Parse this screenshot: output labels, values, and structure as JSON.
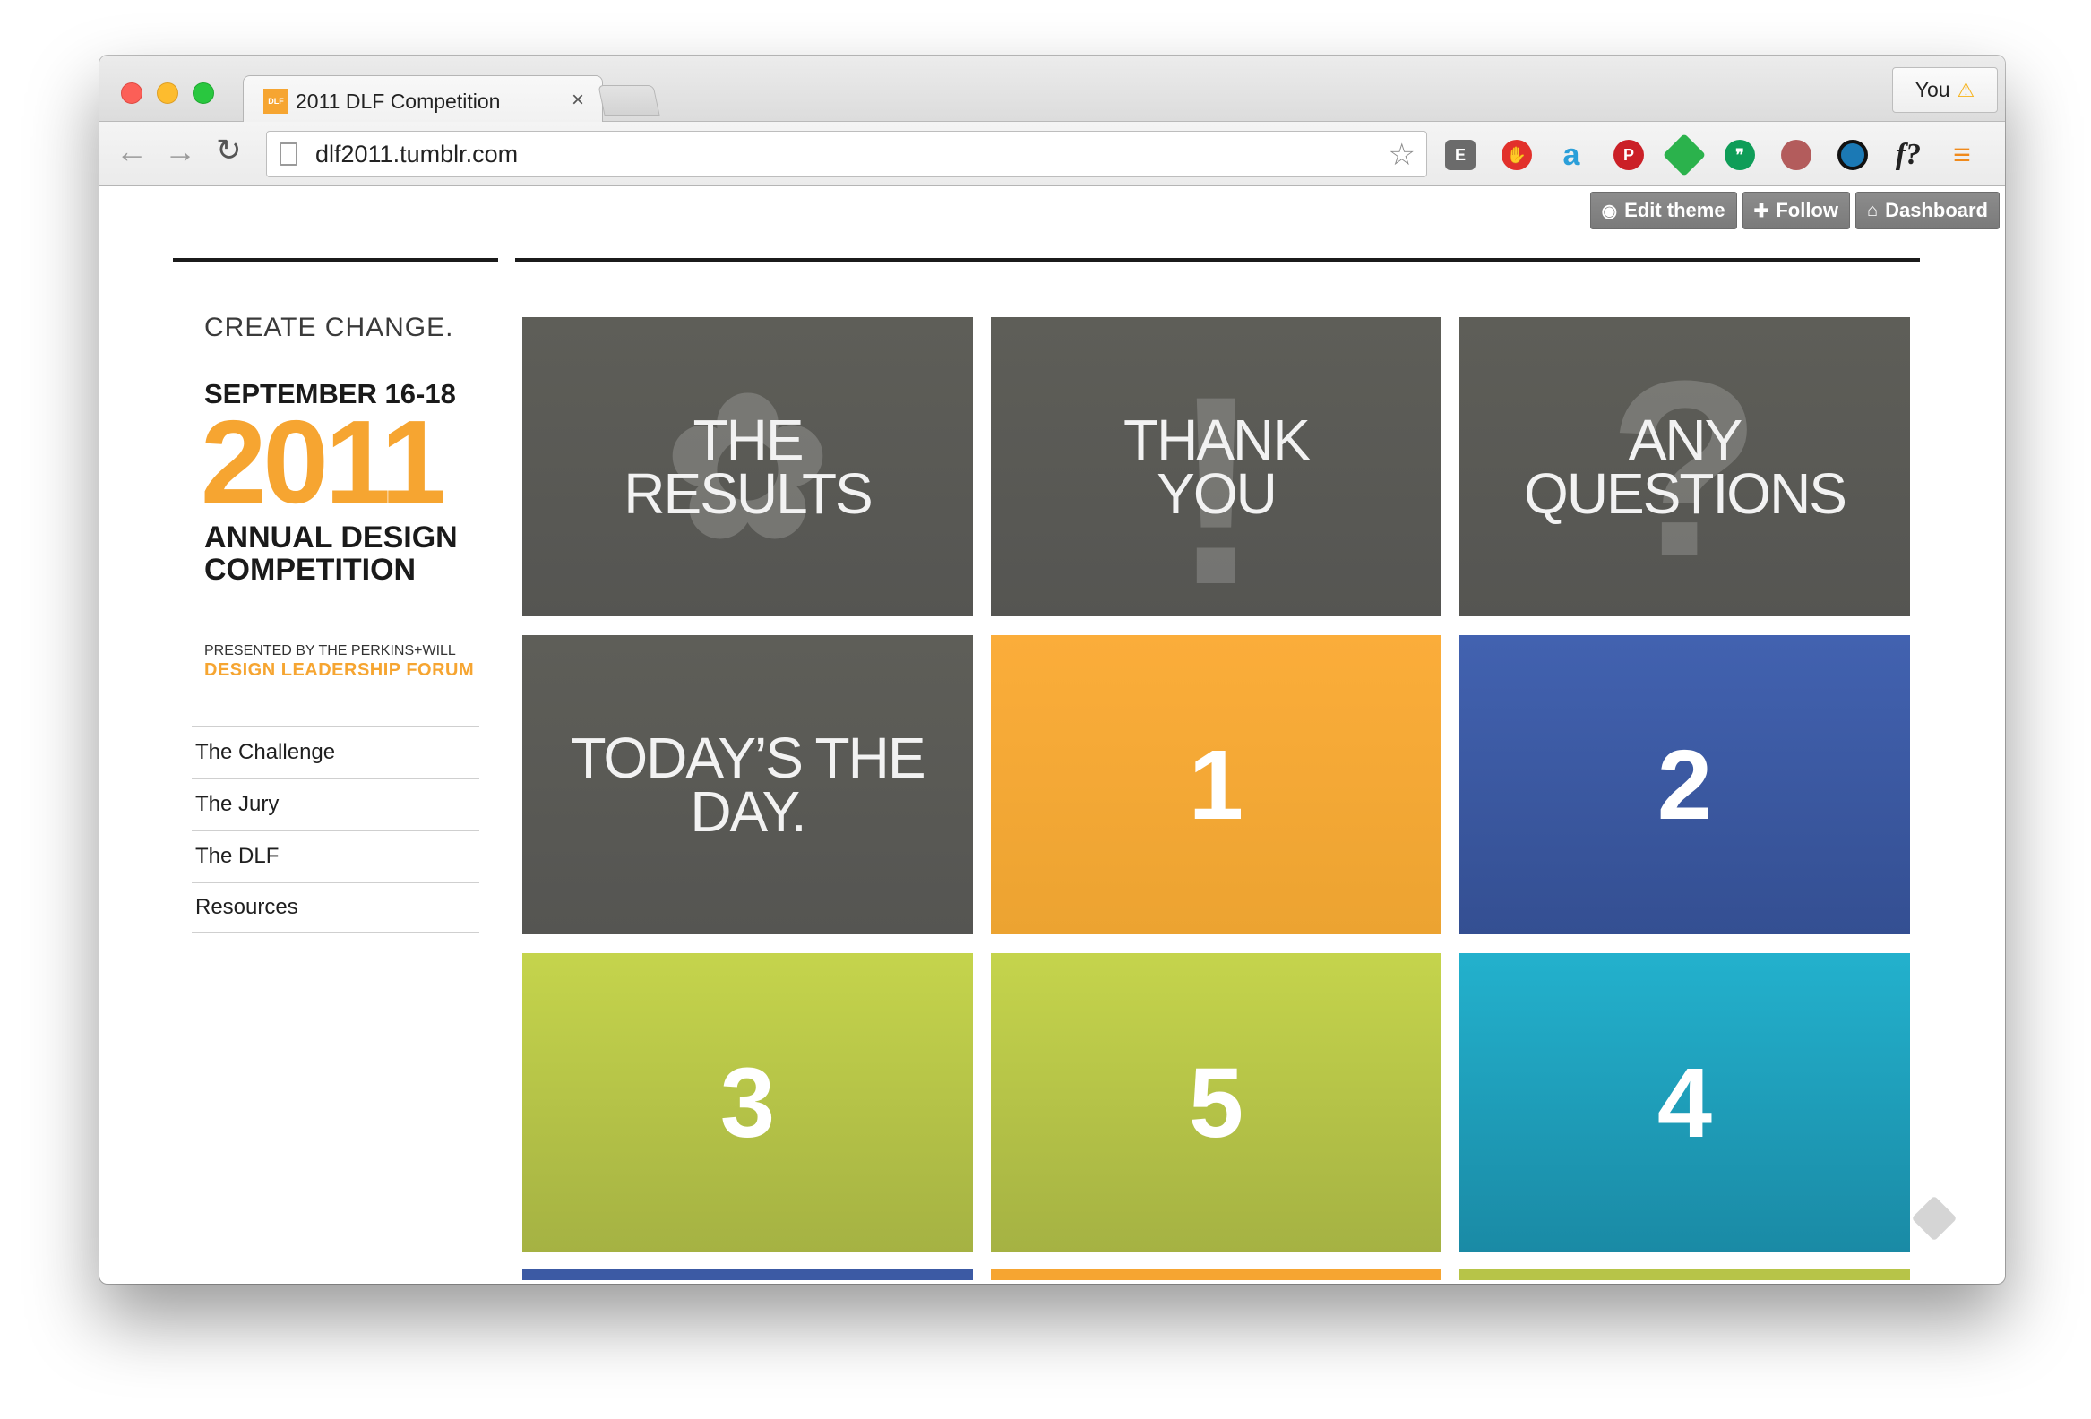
{
  "browser": {
    "tab_title": "2011 DLF Competition",
    "tab_favicon": "DLF",
    "tab_close": "×",
    "profile_name": "You",
    "url": "dlf2011.tumblr.com",
    "icons": [
      "back-icon",
      "forward-icon",
      "reload-icon",
      "bookmark-star-icon",
      "evernote-icon",
      "adblock-icon",
      "amazon-icon",
      "pinterest-icon",
      "feedly-icon",
      "hangouts-icon",
      "apple-icon",
      "eye-icon",
      "font-icon",
      "menu-icon"
    ]
  },
  "tumblr": {
    "edit_theme": "Edit theme",
    "follow": "Follow",
    "dashboard": "Dashboard"
  },
  "brand": {
    "tagline": "CREATE CHANGE.",
    "date": "SEPTEMBER 16-18",
    "year": "2011",
    "competition": "ANNUAL DESIGN COMPETITION",
    "presented": "PRESENTED BY THE PERKINS+WILL",
    "forum": "DESIGN LEADERSHIP FORUM"
  },
  "nav": {
    "items": [
      "The Challenge",
      "The Jury",
      "The DLF",
      "Resources"
    ]
  },
  "tiles": [
    {
      "text": "THE RESULTS",
      "color": "#5a5a55"
    },
    {
      "text": "THANK YOU",
      "color": "#5a5a55"
    },
    {
      "text": "ANY QUESTIONS",
      "color": "#5a5a55"
    },
    {
      "text": "TODAY’S THE DAY.",
      "color": "#5a5a55"
    },
    {
      "text": "1",
      "color": "#f6a531"
    },
    {
      "text": "2",
      "color": "#3c5aa4"
    },
    {
      "text": "3",
      "color": "#b7c448"
    },
    {
      "text": "5",
      "color": "#b7c448"
    },
    {
      "text": "4",
      "color": "#1fa0bd"
    }
  ]
}
